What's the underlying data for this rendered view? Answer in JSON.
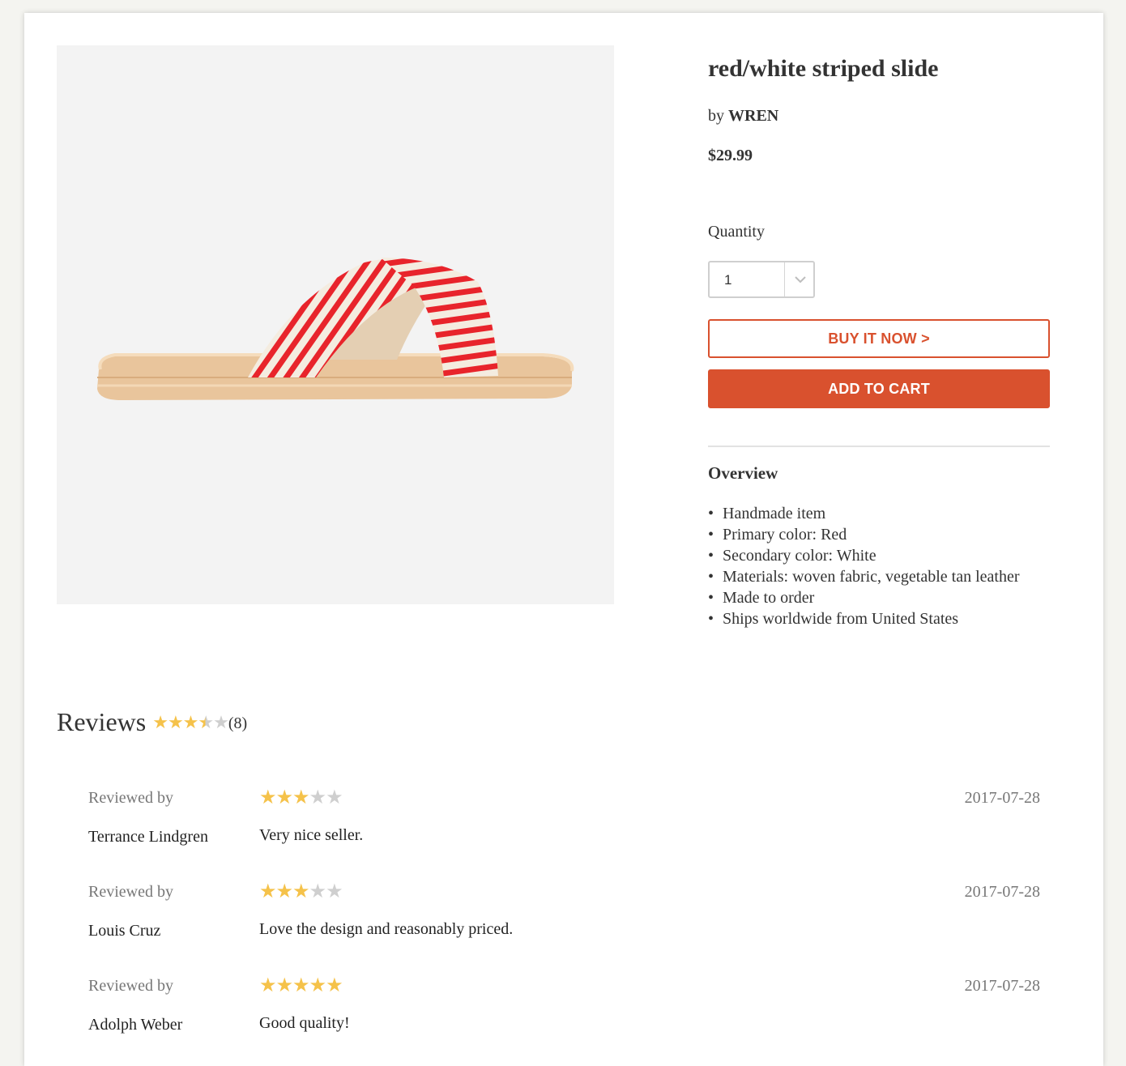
{
  "product": {
    "title": "red/white striped slide",
    "by_prefix": "by",
    "brand": "WREN",
    "price": "$29.99",
    "image_alt": "red and white striped slide sandal"
  },
  "quantity": {
    "label": "Quantity",
    "value": "1"
  },
  "buttons": {
    "buy_now": "BUY IT NOW >",
    "add_to_cart": "ADD TO CART"
  },
  "overview": {
    "title": "Overview",
    "items": [
      "Handmade item",
      "Primary color: Red",
      "Secondary color: White",
      "Materials: woven fabric, vegetable tan leather",
      "Made to order",
      "Ships worldwide from United States"
    ]
  },
  "reviews": {
    "heading": "Reviews",
    "average_rating": 3.5,
    "max_rating": 5,
    "count": "(8)",
    "items": [
      {
        "label": "Reviewed by",
        "reviewer": "Terrance Lindgren",
        "rating": 3,
        "comment": "Very nice seller.",
        "date": "2017-07-28"
      },
      {
        "label": "Reviewed by",
        "reviewer": "Louis Cruz",
        "rating": 3,
        "comment": "Love the design and reasonably priced.",
        "date": "2017-07-28"
      },
      {
        "label": "Reviewed by",
        "reviewer": "Adolph Weber",
        "rating": 5,
        "comment": "Good quality!",
        "date": "2017-07-28"
      }
    ]
  },
  "colors": {
    "accent": "#d9512e",
    "star_filled": "#f5c24a",
    "star_empty": "#cfcfcf"
  }
}
